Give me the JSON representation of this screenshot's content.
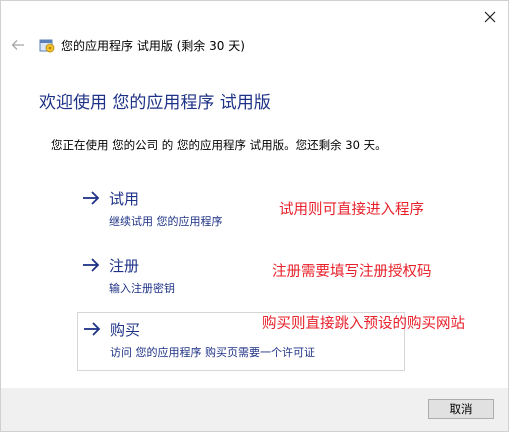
{
  "window": {
    "title": "您的应用程序 试用版 (剩余 30 天)",
    "close_icon": "close-icon",
    "back_icon": "back-arrow-icon",
    "app_icon": "app-installer-icon"
  },
  "main": {
    "heading": "欢迎使用 您的应用程序 试用版",
    "description": "您正在使用 您的公司 的 您的应用程序 试用版。您还剩余 30 天。"
  },
  "options": [
    {
      "title": "试用",
      "subtitle": "继续试用 您的应用程序",
      "icon": "arrow-right-icon"
    },
    {
      "title": "注册",
      "subtitle": "输入注册密钥",
      "icon": "arrow-right-icon"
    },
    {
      "title": "购买",
      "subtitle": "访问 您的应用程序 购买页需要一个许可证",
      "icon": "arrow-right-icon"
    }
  ],
  "annotations": {
    "trial": "试用则可直接进入程序",
    "register": "注册需要填写注册授权码",
    "buy": "购买则直接跳入预设的购买网站"
  },
  "footer": {
    "cancel_label": "取消"
  },
  "colors": {
    "accent": "#1e3287",
    "annotation": "#e8202a",
    "footer_bg": "#f0f0f0"
  }
}
